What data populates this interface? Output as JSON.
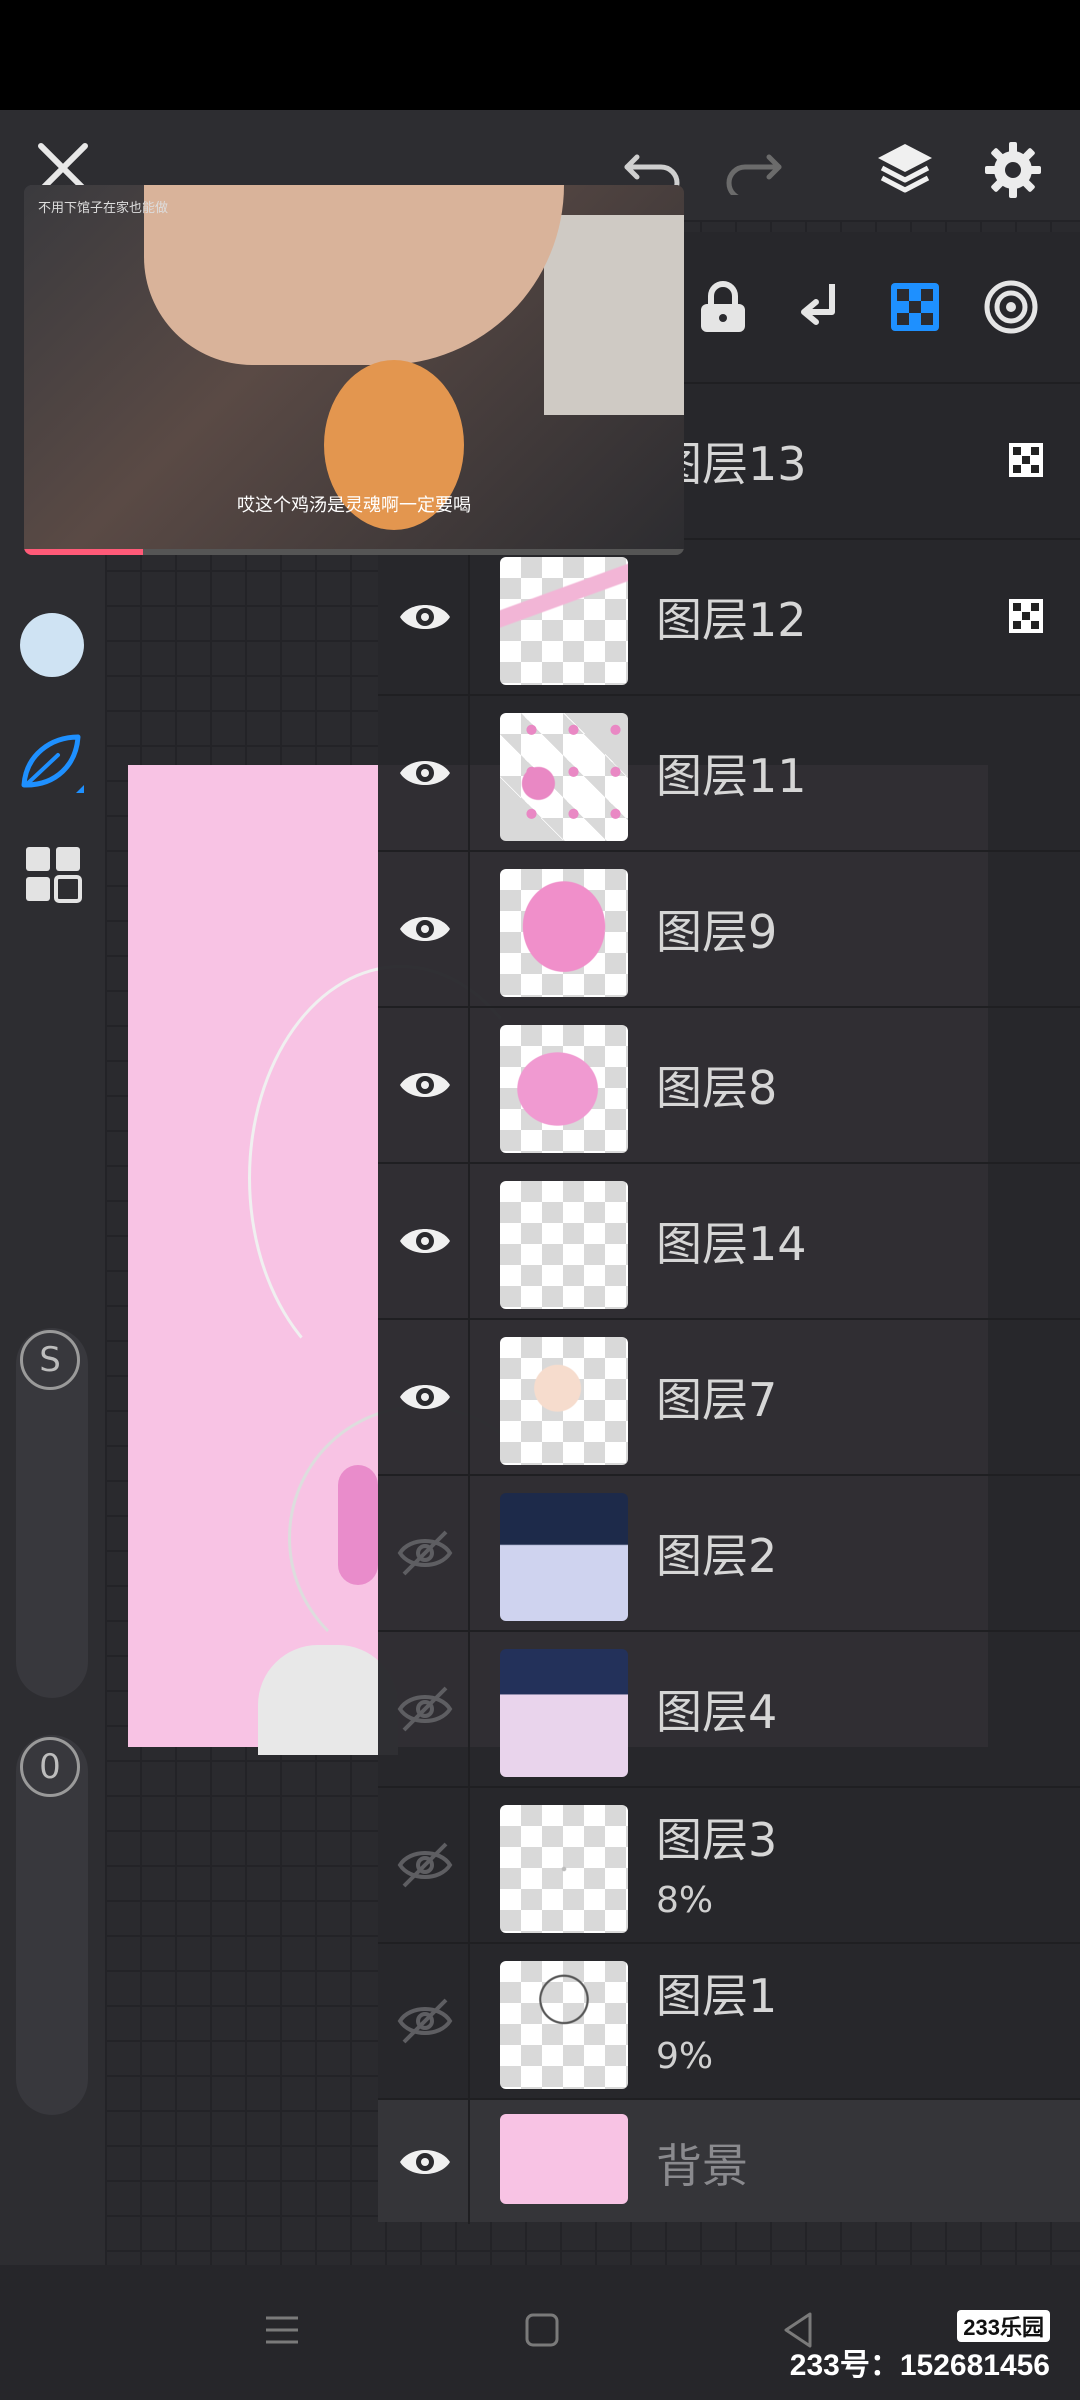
{
  "video": {
    "caption": "哎这个鸡汤是灵魂啊一定要喝",
    "top_text": "不用下馆子在家也能做",
    "progress": 0.18
  },
  "layers": [
    {
      "name": "图层13",
      "visible": true,
      "clip": true
    },
    {
      "name": "图层12",
      "visible": true,
      "clip": true
    },
    {
      "name": "图层11",
      "visible": true
    },
    {
      "name": "图层9",
      "visible": true
    },
    {
      "name": "图层8",
      "visible": true
    },
    {
      "name": "图层14",
      "visible": true
    },
    {
      "name": "图层7",
      "visible": true
    },
    {
      "name": "图层2",
      "visible": false
    },
    {
      "name": "图层4",
      "visible": false
    },
    {
      "name": "图层3",
      "visible": false,
      "opacity": "8%"
    },
    {
      "name": "图层1",
      "visible": false,
      "opacity": "9%"
    },
    {
      "name": "背景",
      "visible": true
    }
  ],
  "left_toolbar": {
    "size_slider_label": "S",
    "opacity_slider_label": "0"
  },
  "colors": {
    "accent": "#1e90ff",
    "canvas_pink": "#f8c3e4",
    "current_color": "#cfe3f3"
  },
  "watermark": {
    "logo": "233乐园",
    "id_text": "233号：152681456"
  }
}
